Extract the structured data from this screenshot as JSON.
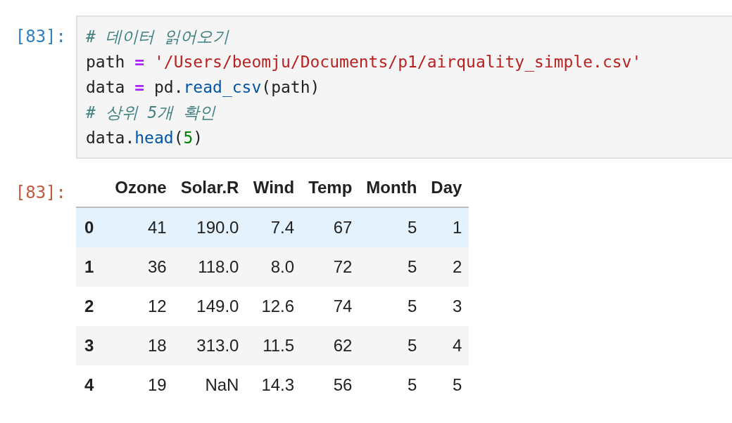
{
  "input_cell": {
    "prompt": "[83]:",
    "lines": [
      [
        {
          "text": "# 데이터 읽어오기",
          "kind": "comment"
        }
      ],
      [
        {
          "text": "path ",
          "kind": "name"
        },
        {
          "text": "=",
          "kind": "operator"
        },
        {
          "text": " '/Users/beomju/Documents/p1/airquality_simple.csv'",
          "kind": "string"
        }
      ],
      [
        {
          "text": "data ",
          "kind": "name"
        },
        {
          "text": "=",
          "kind": "operator"
        },
        {
          "text": " pd.",
          "kind": "name"
        },
        {
          "text": "read_csv",
          "kind": "function"
        },
        {
          "text": "(path)",
          "kind": "name"
        }
      ],
      [
        {
          "text": "# 상위 5개 확인",
          "kind": "comment"
        }
      ],
      [
        {
          "text": "data.",
          "kind": "name"
        },
        {
          "text": "head",
          "kind": "function"
        },
        {
          "text": "(",
          "kind": "name"
        },
        {
          "text": "5",
          "kind": "number"
        },
        {
          "text": ")",
          "kind": "name"
        }
      ]
    ]
  },
  "output_cell": {
    "prompt": "[83]:",
    "table": {
      "columns": [
        "",
        "Ozone",
        "Solar.R",
        "Wind",
        "Temp",
        "Month",
        "Day"
      ],
      "rows": [
        {
          "cells": [
            "0",
            "41",
            "190.0",
            "7.4",
            "67",
            "5",
            "1"
          ],
          "hovered": true
        },
        {
          "cells": [
            "1",
            "36",
            "118.0",
            "8.0",
            "72",
            "5",
            "2"
          ],
          "hovered": false
        },
        {
          "cells": [
            "2",
            "12",
            "149.0",
            "12.6",
            "74",
            "5",
            "3"
          ],
          "hovered": false
        },
        {
          "cells": [
            "3",
            "18",
            "313.0",
            "11.5",
            "62",
            "5",
            "4"
          ],
          "hovered": false
        },
        {
          "cells": [
            "4",
            "19",
            "NaN",
            "14.3",
            "56",
            "5",
            "5"
          ],
          "hovered": false
        }
      ]
    }
  }
}
